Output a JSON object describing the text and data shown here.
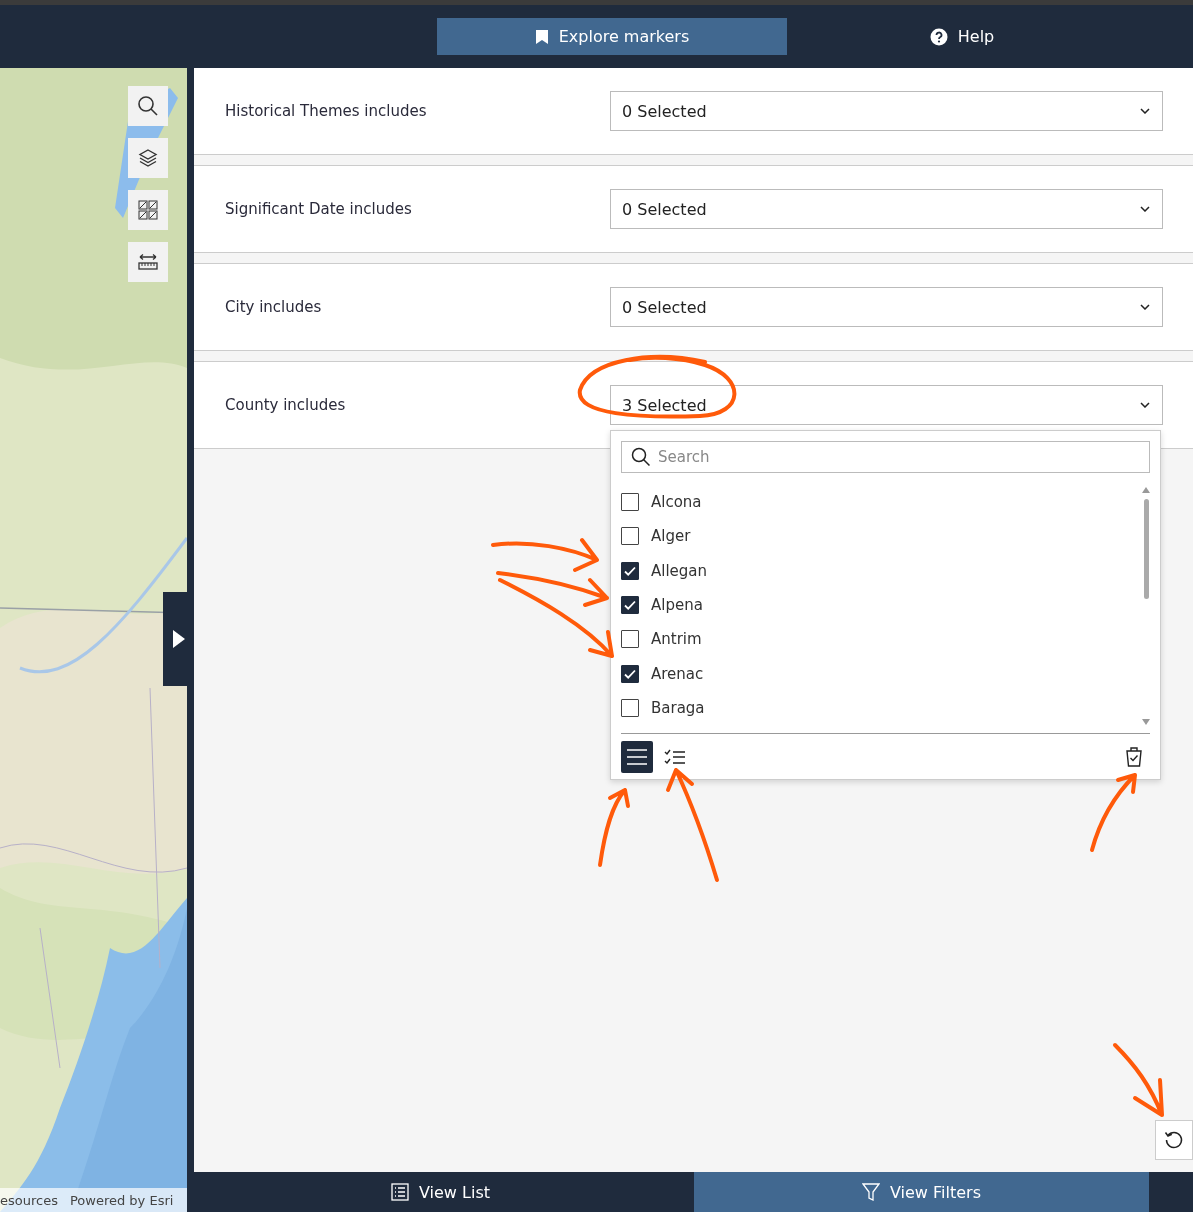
{
  "top_tabs": [
    {
      "label": "Explore markers",
      "kind": "marker",
      "selected": true
    },
    {
      "label": "Help",
      "kind": "help",
      "selected": false
    }
  ],
  "map": {
    "attribution": [
      "esources",
      "Powered by Esri"
    ]
  },
  "filters": [
    {
      "label": "Historical Themes includes",
      "value": "0 Selected"
    },
    {
      "label": "Significant Date includes",
      "value": "0 Selected"
    },
    {
      "label": "City includes",
      "value": "0 Selected"
    },
    {
      "label": "County includes",
      "value": "3 Selected",
      "dropdown": {
        "placeholder": "Search",
        "options": [
          {
            "label": "Alcona",
            "checked": false
          },
          {
            "label": "Alger",
            "checked": false
          },
          {
            "label": "Allegan",
            "checked": true
          },
          {
            "label": "Alpena",
            "checked": true
          },
          {
            "label": "Antrim",
            "checked": false
          },
          {
            "label": "Arenac",
            "checked": true
          },
          {
            "label": "Baraga",
            "checked": false
          }
        ],
        "view_modes": [
          {
            "kind": "all",
            "selected": true
          },
          {
            "kind": "selected",
            "selected": false
          }
        ]
      }
    }
  ],
  "bottom_tabs": [
    {
      "label": "View List",
      "kind": "list",
      "selected": false
    },
    {
      "label": "View Filters",
      "kind": "filter",
      "selected": true
    }
  ]
}
